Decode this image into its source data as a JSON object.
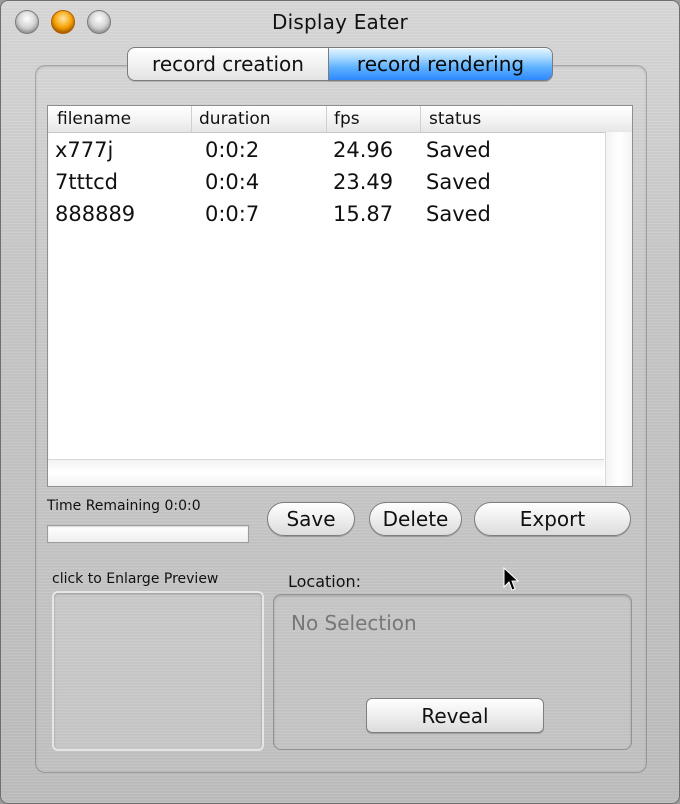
{
  "window": {
    "title": "Display Eater"
  },
  "tabs": [
    {
      "label": "record creation",
      "selected": false
    },
    {
      "label": "record rendering",
      "selected": true
    }
  ],
  "table": {
    "columns": [
      "filename",
      "duration",
      "fps",
      "status"
    ],
    "rows": [
      [
        "x777j",
        "0:0:2",
        "24.96",
        "Saved"
      ],
      [
        "7tttcd",
        "0:0:4",
        "23.49",
        "Saved"
      ],
      [
        "888889",
        "0:0:7",
        "15.87",
        "Saved"
      ]
    ]
  },
  "time_remaining_label": "Time Remaining 0:0:0",
  "buttons": {
    "save": "Save",
    "delete": "Delete",
    "export": "Export",
    "reveal": "Reveal"
  },
  "preview": {
    "label": "click to Enlarge Preview"
  },
  "location": {
    "label": "Location:",
    "value": "No Selection"
  },
  "colors": {
    "selected_tab": "#5fb2ff",
    "minimize_button": "#f6a100"
  },
  "icons": {
    "close": "close-button",
    "minimize": "minimize-button",
    "zoom": "zoom-button",
    "cursor": "mouse-pointer-icon"
  }
}
